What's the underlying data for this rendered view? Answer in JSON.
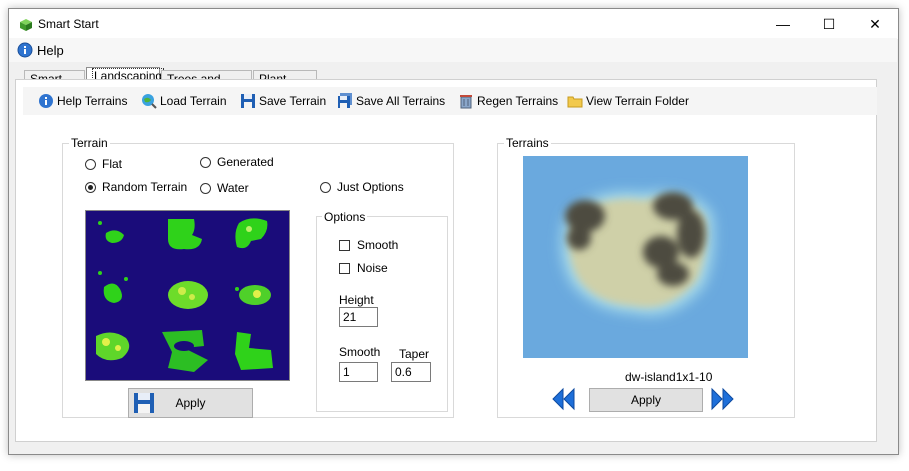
{
  "window": {
    "title": "Smart Start",
    "minimize_glyph": "—",
    "maximize_glyph": "☐",
    "close_glyph": "✕"
  },
  "menu": {
    "help_label": "Help"
  },
  "tabs": [
    {
      "label": "Smart Start",
      "active": false
    },
    {
      "label": "Landscaping",
      "active": true
    },
    {
      "label": "Trees and Plants",
      "active": false
    },
    {
      "label": "Plant Editor",
      "active": false
    }
  ],
  "toolbar": {
    "help_terrains": "Help Terrains",
    "load_terrain": "Load Terrain",
    "save_terrain": "Save Terrain",
    "save_all_terrains": "Save All Terrains",
    "regen_terrains": "Regen Terrains",
    "view_terrain_folder": "View Terrain Folder"
  },
  "terrain_group": {
    "title": "Terrain",
    "radio_flat": "Flat",
    "radio_generated": "Generated",
    "radio_random": "Random Terrain",
    "radio_water": "Water",
    "radio_just_options": "Just Options",
    "selected": "Random Terrain",
    "apply_label": "Apply"
  },
  "options_group": {
    "title": "Options",
    "smooth_check": "Smooth",
    "noise_check": "Noise",
    "height_label": "Height",
    "height_value": "21",
    "smooth_label": "Smooth",
    "smooth_value": "1",
    "taper_label": "Taper",
    "taper_value": "0.6"
  },
  "terrains_group": {
    "title": "Terrains",
    "selected_name": "dw-island1x1-10",
    "apply_label": "Apply"
  },
  "colors": {
    "grid_bg": "#1a0c7a",
    "island_green": "#2fd21a",
    "water_blue": "#6aa9de",
    "sand": "#cfd0a8",
    "rock": "#4e4c40",
    "arrow_blue": "#1e6fd9"
  }
}
